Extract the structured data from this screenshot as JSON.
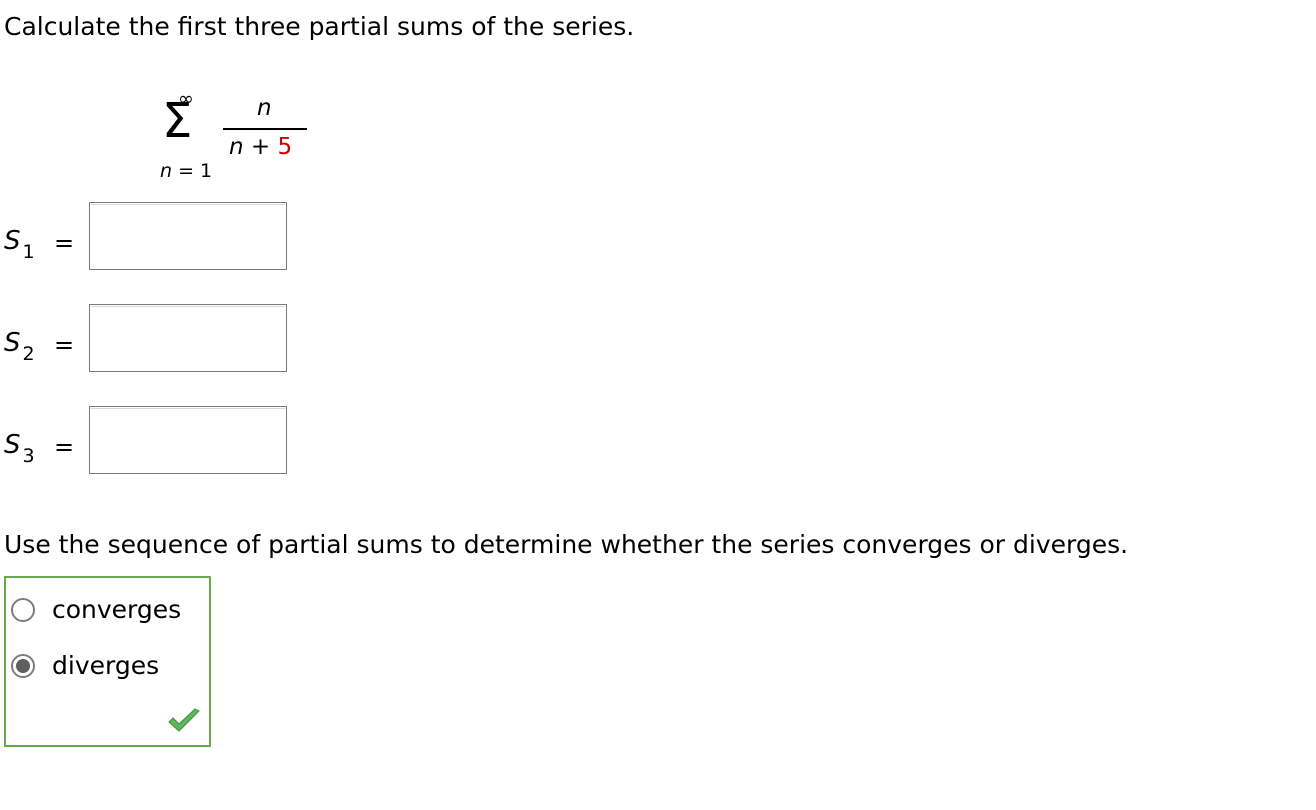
{
  "question1": "Calculate the first three partial sums of the series.",
  "series": {
    "upper_limit": "∞",
    "sigma": "Σ",
    "lower_var": "n",
    "lower_eq": " = 1",
    "numerator": "n",
    "denominator_var": "n",
    "denominator_op": " + ",
    "denominator_const": "5"
  },
  "partial_sums": [
    {
      "symbol": "S",
      "subscript": "1",
      "equals": "=",
      "value": ""
    },
    {
      "symbol": "S",
      "subscript": "2",
      "equals": "=",
      "value": ""
    },
    {
      "symbol": "S",
      "subscript": "3",
      "equals": "=",
      "value": ""
    }
  ],
  "question2": "Use the sequence of partial sums to determine whether the series converges or diverges.",
  "choices": [
    {
      "label": "converges",
      "selected": false
    },
    {
      "label": "diverges",
      "selected": true
    }
  ],
  "feedback": {
    "status": "correct",
    "icon": "check-mark-icon",
    "color": "#5cb85c"
  },
  "colors": {
    "panel_border": "#6aa84f",
    "constant": "#cc0000"
  }
}
